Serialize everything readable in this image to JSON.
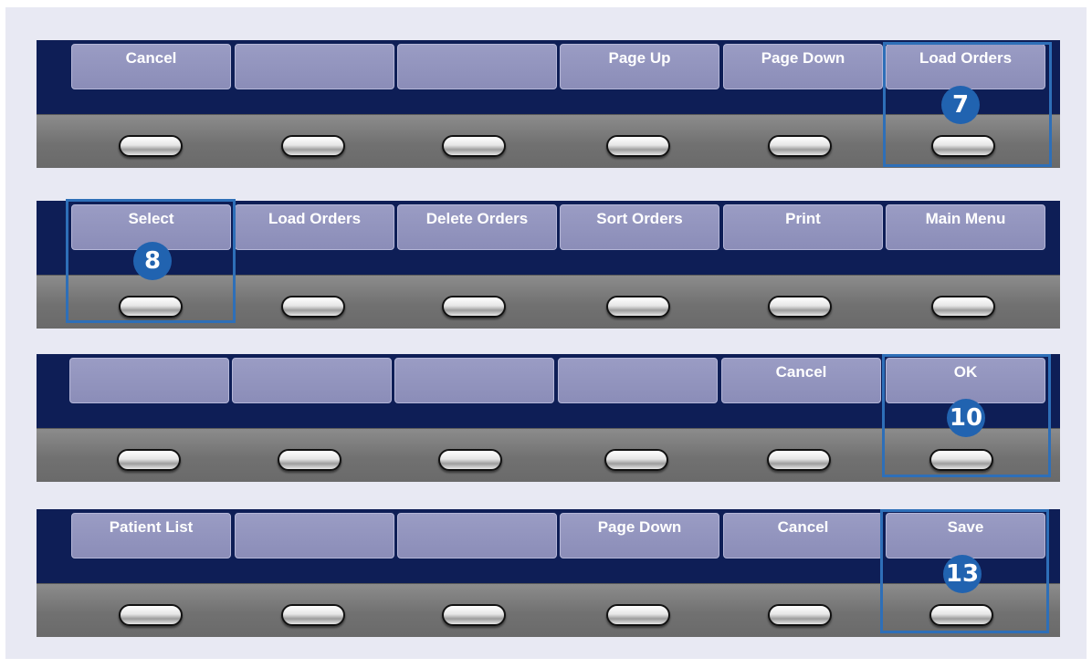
{
  "panels": [
    {
      "softkeys": [
        "Cancel",
        "",
        "",
        "Page Up",
        "Page Down",
        "Load Orders"
      ],
      "badge": "7"
    },
    {
      "softkeys": [
        "Select",
        "Load Orders",
        "Delete Orders",
        "Sort Orders",
        "Print",
        "Main Menu"
      ],
      "badge": "8"
    },
    {
      "softkeys": [
        "",
        "",
        "",
        "",
        "Cancel",
        "OK"
      ],
      "badge": "10"
    },
    {
      "softkeys": [
        "Patient List",
        "",
        "",
        "Page Down",
        "Cancel",
        "Save"
      ],
      "badge": "13"
    }
  ],
  "colors": {
    "panel_bg": "#0e1e56",
    "softkey_bg": "#8b8db8",
    "callout": "#2e6fb8",
    "badge_bg": "#2163b0",
    "page_bg": "#e8e9f3"
  }
}
